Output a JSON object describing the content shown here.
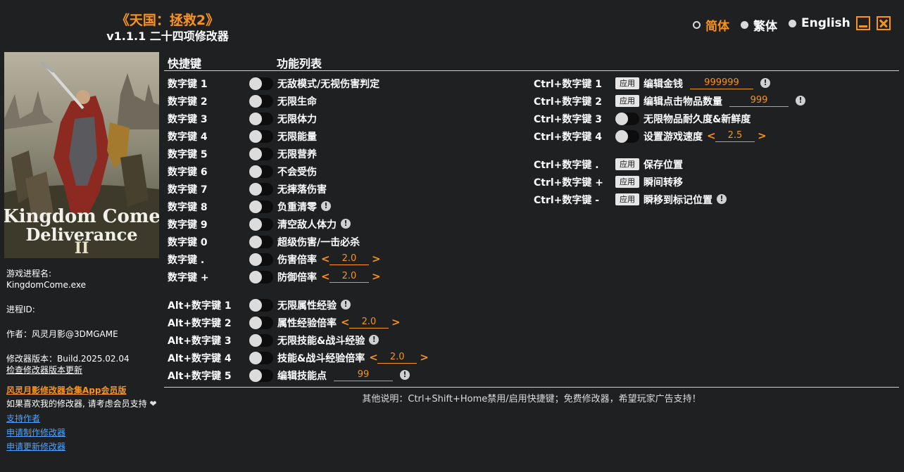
{
  "header": {
    "game_title": "《天国：拯救2》",
    "trainer_version": "v1.1.1 二十四项修改器"
  },
  "languages": [
    {
      "label": "简体",
      "active": true
    },
    {
      "label": "繁体",
      "active": false
    },
    {
      "label": "English",
      "active": false
    }
  ],
  "cover": {
    "title_line1": "Kingdom Come",
    "title_line2": "Deliverance",
    "numeral": "II"
  },
  "sidebar": {
    "process_label": "游戏进程名:",
    "process_name": "KingdomCome.exe",
    "pid_label": "进程ID:",
    "author": "作者：风灵月影@3DMGAME",
    "version": "修改器版本：Build.2025.02.04",
    "check_update": "检查修改器版本更新",
    "app_link": "风灵月影修改器合集App会员版",
    "support_text": "如果喜欢我的修改器, 请考虑会员支持",
    "heart": "❤",
    "support_author": "支持作者",
    "request_make": "申请制作修改器",
    "request_update": "申请更新修改器"
  },
  "columns": {
    "hotkey_header": "快捷键",
    "feature_header": "功能列表"
  },
  "left_rows": [
    {
      "key": "数字键 1",
      "label": "无敌模式/无视伤害判定"
    },
    {
      "key": "数字键 2",
      "label": "无限生命"
    },
    {
      "key": "数字键 3",
      "label": "无限体力"
    },
    {
      "key": "数字键 4",
      "label": "无限能量"
    },
    {
      "key": "数字键 5",
      "label": "无限营养"
    },
    {
      "key": "数字键 6",
      "label": "不会受伤"
    },
    {
      "key": "数字键 7",
      "label": "无摔落伤害"
    },
    {
      "key": "数字键 8",
      "label": "负重清零",
      "info": "!"
    },
    {
      "key": "数字键 9",
      "label": "清空敌人体力",
      "info": "!"
    },
    {
      "key": "数字键 0",
      "label": "超级伤害/一击必杀"
    },
    {
      "key": "数字键 .",
      "label": "伤害倍率",
      "value": "2.0"
    },
    {
      "key": "数字键 +",
      "label": "防御倍率",
      "value": "2.0"
    },
    {
      "key": "Alt+数字键 1",
      "label": "无限属性经验",
      "info": "!"
    },
    {
      "key": "Alt+数字键 2",
      "label": "属性经验倍率",
      "value": "2.0"
    },
    {
      "key": "Alt+数字键 3",
      "label": "无限技能&战斗经验",
      "info": "!"
    },
    {
      "key": "Alt+数字键 4",
      "label": "技能&战斗经验倍率",
      "value": "2.0"
    },
    {
      "key": "Alt+数字键 5",
      "label": "编辑技能点",
      "edit_value": "99",
      "info": "!"
    }
  ],
  "right_rows": [
    {
      "key": "Ctrl+数字键 1",
      "apply": "应用",
      "label": "编辑金钱",
      "edit_value": "999999",
      "info": "!"
    },
    {
      "key": "Ctrl+数字键 2",
      "apply": "应用",
      "label": "编辑点击物品数量",
      "edit_value": "999",
      "info": "!"
    },
    {
      "key": "Ctrl+数字键 3",
      "label": "无限物品耐久度&新鲜度"
    },
    {
      "key": "Ctrl+数字键 4",
      "label": "设置游戏速度",
      "value": "2.5"
    },
    {
      "key": "Ctrl+数字键 .",
      "apply": "应用",
      "label": "保存位置"
    },
    {
      "key": "Ctrl+数字键 +",
      "apply": "应用",
      "label": "瞬间转移"
    },
    {
      "key": "Ctrl+数字键 -",
      "apply": "应用",
      "label": "瞬移到标记位置",
      "info": "!"
    }
  ],
  "arrows": {
    "left": "<",
    "right": ">"
  },
  "footer": {
    "note": "其他说明：Ctrl+Shift+Home禁用/启用快捷键；免费修改器，希望玩家广告支持！"
  },
  "colors": {
    "accent": "#f7931e",
    "background": "#1f2022",
    "link": "#4da3ff"
  }
}
